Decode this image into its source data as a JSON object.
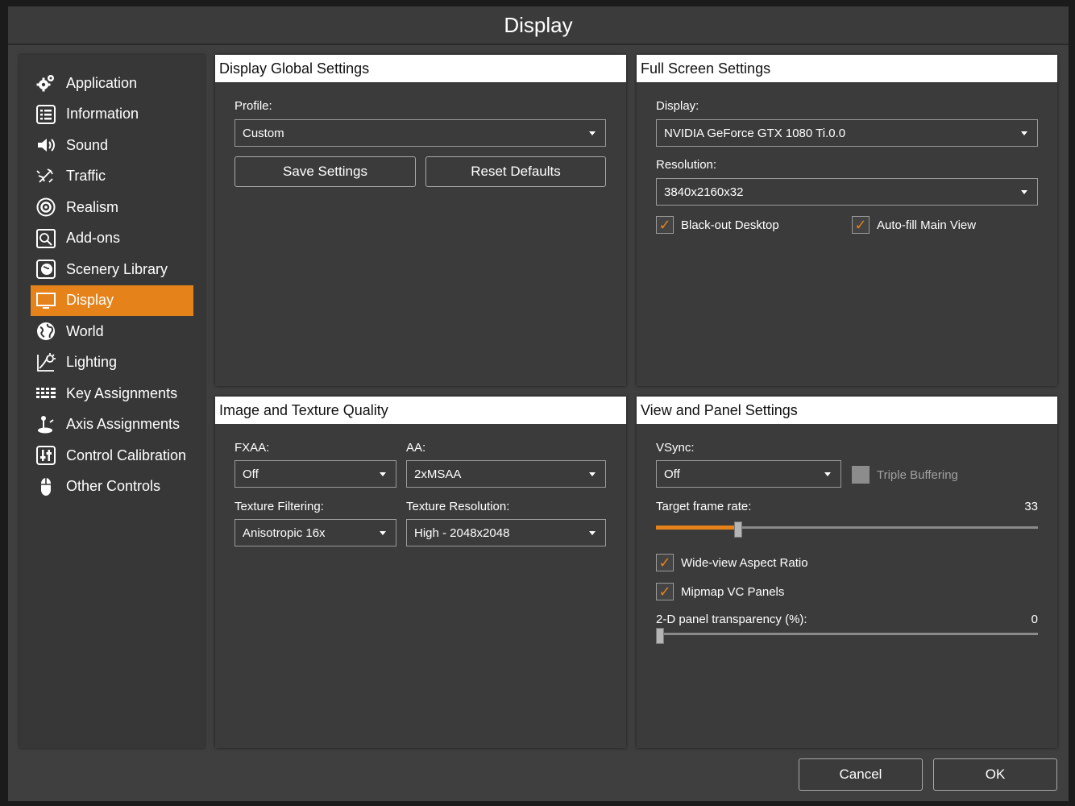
{
  "window": {
    "title": "Display"
  },
  "sidebar": {
    "items": [
      {
        "label": "Application",
        "icon": "gear-icon"
      },
      {
        "label": "Information",
        "icon": "list-icon"
      },
      {
        "label": "Sound",
        "icon": "speaker-icon"
      },
      {
        "label": "Traffic",
        "icon": "airplane-icon"
      },
      {
        "label": "Realism",
        "icon": "realism-icon"
      },
      {
        "label": "Add-ons",
        "icon": "addons-icon"
      },
      {
        "label": "Scenery Library",
        "icon": "scenery-icon"
      },
      {
        "label": "Display",
        "icon": "monitor-icon",
        "active": true
      },
      {
        "label": "World",
        "icon": "globe-icon"
      },
      {
        "label": "Lighting",
        "icon": "lighting-icon"
      },
      {
        "label": "Key Assignments",
        "icon": "keyboard-icon"
      },
      {
        "label": "Axis Assignments",
        "icon": "joystick-icon"
      },
      {
        "label": "Control Calibration",
        "icon": "calibration-icon"
      },
      {
        "label": "Other Controls",
        "icon": "mouse-icon"
      }
    ]
  },
  "global": {
    "header": "Display Global Settings",
    "profile_label": "Profile:",
    "profile_value": "Custom",
    "save_label": "Save Settings",
    "reset_label": "Reset Defaults"
  },
  "fullscreen": {
    "header": "Full Screen Settings",
    "display_label": "Display:",
    "display_value": "NVIDIA GeForce GTX 1080 Ti.0.0",
    "resolution_label": "Resolution:",
    "resolution_value": "3840x2160x32",
    "blackout_label": "Black-out Desktop",
    "blackout_checked": true,
    "autofill_label": "Auto-fill Main View",
    "autofill_checked": true
  },
  "quality": {
    "header": "Image and Texture Quality",
    "fxaa_label": "FXAA:",
    "fxaa_value": "Off",
    "aa_label": "AA:",
    "aa_value": "2xMSAA",
    "filtering_label": "Texture Filtering:",
    "filtering_value": "Anisotropic 16x",
    "texres_label": "Texture Resolution:",
    "texres_value": "High - 2048x2048"
  },
  "view": {
    "header": "View and Panel Settings",
    "vsync_label": "VSync:",
    "vsync_value": "Off",
    "triple_label": "Triple Buffering",
    "triple_checked": false,
    "framerate_label": "Target frame rate:",
    "framerate_value": "33",
    "framerate_fraction": 0.215,
    "wideview_label": "Wide-view Aspect Ratio",
    "wideview_checked": true,
    "mipmap_label": "Mipmap VC Panels",
    "mipmap_checked": true,
    "transparency_label": "2-D panel transparency (%):",
    "transparency_value": "0",
    "transparency_fraction": 0.0
  },
  "footer": {
    "cancel_label": "Cancel",
    "ok_label": "OK"
  },
  "colors": {
    "accent": "#e5831a",
    "panel": "#3b3b3b",
    "background": "#3f3f3f"
  }
}
